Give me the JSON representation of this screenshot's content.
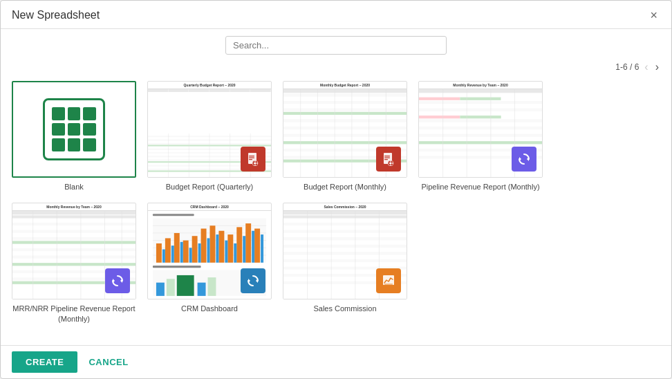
{
  "dialog": {
    "title": "New Spreadsheet",
    "close_label": "×"
  },
  "search": {
    "placeholder": "Search..."
  },
  "pagination": {
    "text": "1-6 / 6",
    "prev_label": "‹",
    "next_label": "›"
  },
  "templates": [
    {
      "id": "blank",
      "label": "Blank",
      "type": "blank",
      "selected": true
    },
    {
      "id": "budget-quarterly",
      "label": "Budget Report (Quarterly)",
      "type": "spreadsheet",
      "overlay": "red"
    },
    {
      "id": "budget-monthly",
      "label": "Budget Report (Monthly)",
      "type": "spreadsheet",
      "overlay": "red"
    },
    {
      "id": "pipeline-revenue",
      "label": "Pipeline Revenue Report (Monthly)",
      "type": "spreadsheet",
      "overlay": "purple"
    },
    {
      "id": "mrr-nrr",
      "label": "MRR/NRR Pipeline Revenue Report (Monthly)",
      "type": "spreadsheet",
      "overlay": "purple"
    },
    {
      "id": "crm-dashboard",
      "label": "CRM Dashboard",
      "type": "chart",
      "overlay": "blue"
    },
    {
      "id": "sales-commission",
      "label": "Sales Commission",
      "type": "spreadsheet",
      "overlay": "orange"
    }
  ],
  "footer": {
    "create_label": "CREATE",
    "cancel_label": "CANCEL"
  }
}
